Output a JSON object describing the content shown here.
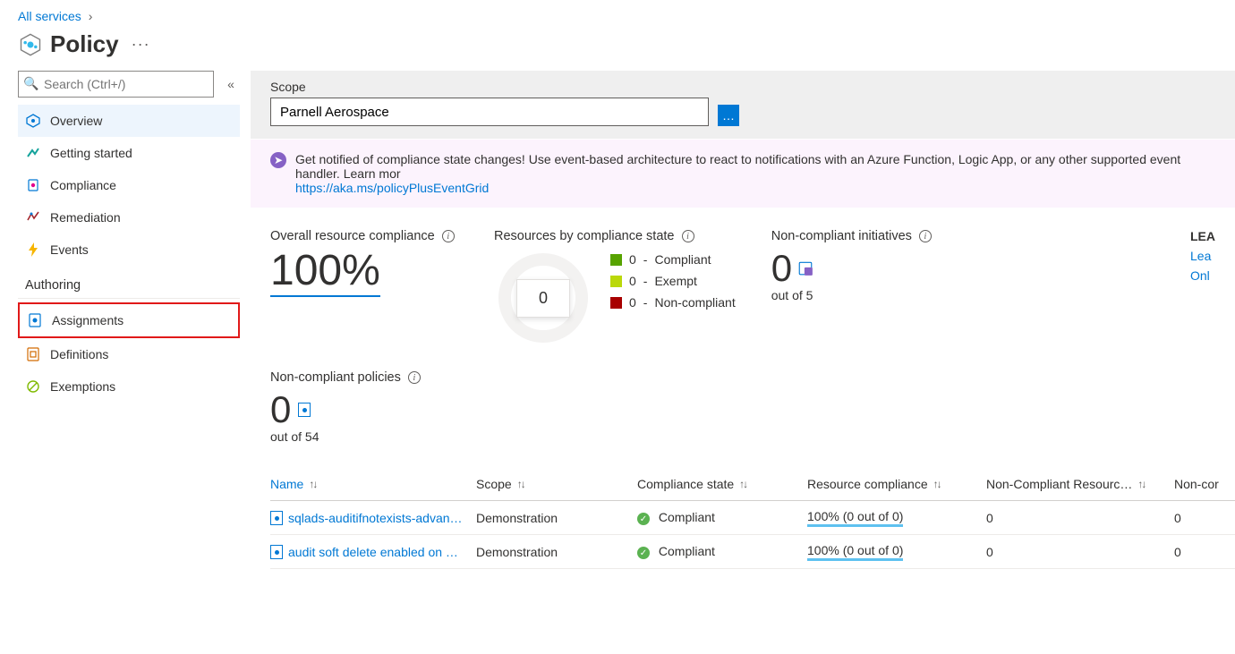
{
  "breadcrumb": {
    "all_services": "All services",
    "chevron": "›"
  },
  "page_title": "Policy",
  "search_placeholder": "Search (Ctrl+/)",
  "sidebar": {
    "items": [
      {
        "label": "Overview",
        "icon": "overview-icon",
        "active": true
      },
      {
        "label": "Getting started",
        "icon": "getting-started-icon",
        "active": false
      },
      {
        "label": "Compliance",
        "icon": "compliance-icon",
        "active": false
      },
      {
        "label": "Remediation",
        "icon": "remediation-icon",
        "active": false
      },
      {
        "label": "Events",
        "icon": "events-icon",
        "active": false
      }
    ],
    "authoring_label": "Authoring",
    "authoring_items": [
      {
        "label": "Assignments",
        "icon": "assignments-icon",
        "highlight": true
      },
      {
        "label": "Definitions",
        "icon": "definitions-icon",
        "highlight": false
      },
      {
        "label": "Exemptions",
        "icon": "exemptions-icon",
        "highlight": false
      }
    ]
  },
  "scope": {
    "label": "Scope",
    "value": "Parnell Aerospace"
  },
  "banner": {
    "text": "Get notified of compliance state changes! Use event-based architecture to react to notifications with an Azure Function, Logic App, or any other supported event handler. Learn mor",
    "link_text": "https://aka.ms/policyPlusEventGrid"
  },
  "stats": {
    "overall_label": "Overall resource compliance",
    "overall_value": "100%",
    "resources_label": "Resources by compliance state",
    "donut_center": "0",
    "legend": [
      {
        "count": "0",
        "label": "Compliant",
        "color": "sw-green"
      },
      {
        "count": "0",
        "label": "Exempt",
        "color": "sw-lime"
      },
      {
        "count": "0",
        "label": "Non-compliant",
        "color": "sw-red"
      }
    ],
    "non_init_label": "Non-compliant initiatives",
    "non_init_value": "0",
    "non_init_sub": "out of 5",
    "learn_head": "LEA",
    "learn_link1": "Lea",
    "learn_link2": "Onl",
    "non_pol_label": "Non-compliant policies",
    "non_pol_value": "0",
    "non_pol_sub": "out of 54"
  },
  "table": {
    "columns": {
      "name": "Name",
      "scope": "Scope",
      "compliance_state": "Compliance state",
      "resource_compliance": "Resource compliance",
      "non_compliant_resources": "Non-Compliant Resourc…",
      "non_col_tail": "Non-cor"
    },
    "rows": [
      {
        "name": "sqlads-auditifnotexists-advan…",
        "scope": "Demonstration",
        "compliance_state": "Compliant",
        "resource_compliance": "100% (0 out of 0)",
        "non_compliant_resources": "0",
        "tail": "0"
      },
      {
        "name": "audit soft delete enabled on …",
        "scope": "Demonstration",
        "compliance_state": "Compliant",
        "resource_compliance": "100% (0 out of 0)",
        "non_compliant_resources": "0",
        "tail": "0"
      }
    ]
  },
  "chart_data": {
    "type": "pie",
    "title": "Resources by compliance state",
    "categories": [
      "Compliant",
      "Exempt",
      "Non-compliant"
    ],
    "values": [
      0,
      0,
      0
    ],
    "total_label": "0"
  }
}
